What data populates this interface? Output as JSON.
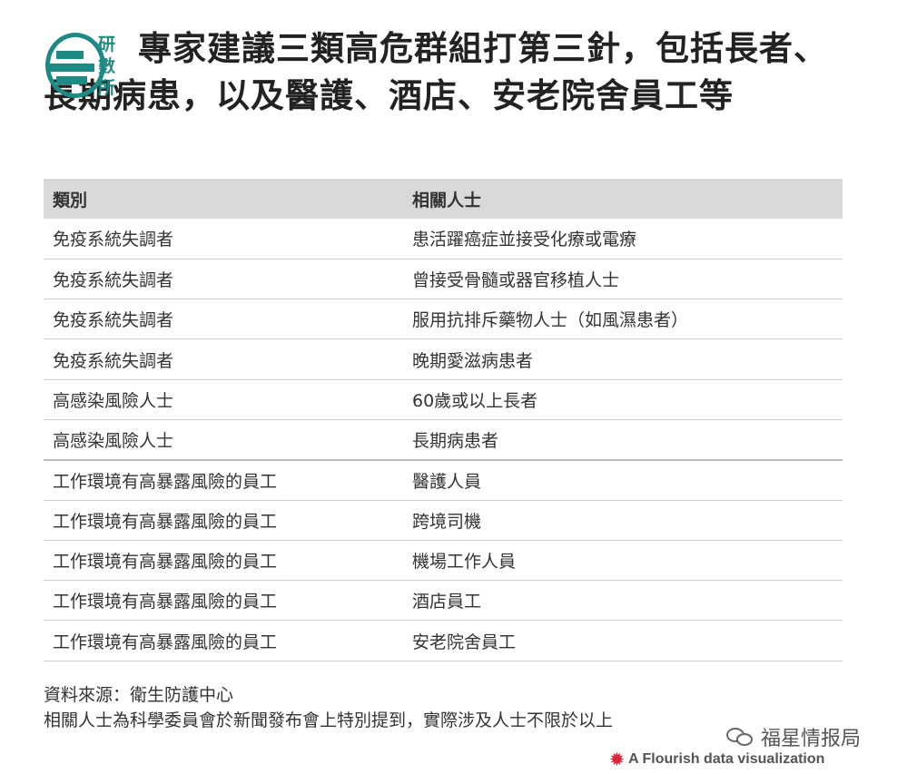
{
  "header": {
    "logo_text": [
      "研",
      "數",
      "所"
    ],
    "title": "專家建議三類高危群組打第三針，包括長者、長期病患，以及醫護、酒店、安老院舍員工等"
  },
  "table": {
    "headers": [
      "類別",
      "相關人士"
    ],
    "rows": [
      [
        "免疫系統失調者",
        "患活躍癌症並接受化療或電療"
      ],
      [
        "免疫系統失調者",
        "曾接受骨髓或器官移植人士"
      ],
      [
        "免疫系統失調者",
        "服用抗排斥藥物人士（如風濕患者）"
      ],
      [
        "免疫系統失調者",
        "晚期愛滋病患者"
      ],
      [
        "高感染風險人士",
        "60歲或以上長者"
      ],
      [
        "高感染風險人士",
        "長期病患者"
      ],
      [
        "工作環境有高暴露風險的員工",
        "醫護人員"
      ],
      [
        "工作環境有高暴露風險的員工",
        "跨境司機"
      ],
      [
        "工作環境有高暴露風險的員工",
        "機場工作人員"
      ],
      [
        "工作環境有高暴露風險的員工",
        "酒店員工"
      ],
      [
        "工作環境有高暴露風險的員工",
        "安老院舍員工"
      ]
    ]
  },
  "footer": {
    "source": "資料來源：衛生防護中心",
    "note": "相關人士為科學委員會於新聞發布會上特別提到，實際涉及人士不限於以上"
  },
  "watermark": "福星情报局",
  "credit": "A Flourish data visualization",
  "colors": {
    "logo": "#1f8a84",
    "header_bg": "#d9d9d9",
    "flourish_icon": "#d7263d"
  }
}
